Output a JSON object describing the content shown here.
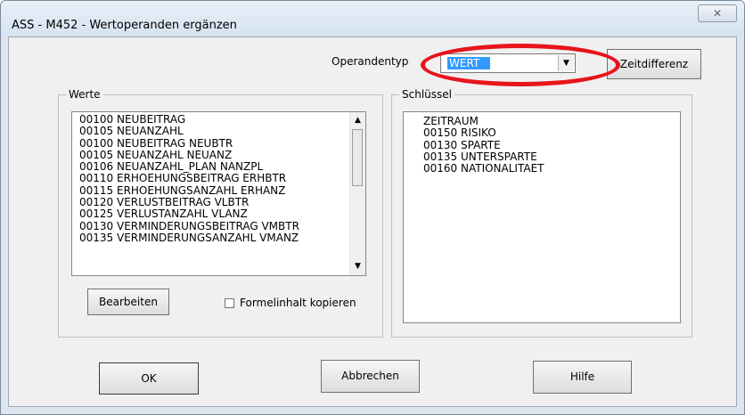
{
  "window": {
    "title": "ASS - M452 - Wertoperanden ergänzen",
    "close_glyph": "✕"
  },
  "operand": {
    "label": "Operandentyp",
    "value": "WERT",
    "dropdown_glyph": "▼"
  },
  "zeitdifferenz_label": "Zeitdifferenz",
  "werte": {
    "title": "Werte",
    "items": [
      "00100  NEUBEITRAG",
      "00105  NEUANZAHL",
      "00100  NEUBEITRAG  NEUBTR",
      "00105  NEUANZAHL  NEUANZ",
      "00106  NEUANZAHL_PLAN  NANZPL",
      "00110  ERHOEHUNGSBEITRAG  ERHBTR",
      "00115  ERHOEHUNGSANZAHL  ERHANZ",
      "00120  VERLUSTBEITRAG  VLBTR",
      "00125  VERLUSTANZAHL  VLANZ",
      "00130  VERMINDERUNGSBEITRAG  VMBTR",
      "00135  VERMINDERUNGSANZAHL  VMANZ"
    ],
    "scroll_up_glyph": "▲",
    "scroll_down_glyph": "▼",
    "bearbeiten_label": "Bearbeiten",
    "copy_checkbox_label": "Formelinhalt kopieren",
    "copy_checked": false
  },
  "schluessel": {
    "title": "Schlüssel",
    "items": [
      "ZEITRAUM",
      "00150  RISIKO",
      "00130  SPARTE",
      "00135  UNTERSPARTE",
      "00160  NATIONALITAET"
    ]
  },
  "buttons": {
    "ok": "OK",
    "cancel": "Abbrechen",
    "help": "Hilfe"
  },
  "colors": {
    "selection": "#3399ff",
    "annotation": "#e8141b"
  }
}
